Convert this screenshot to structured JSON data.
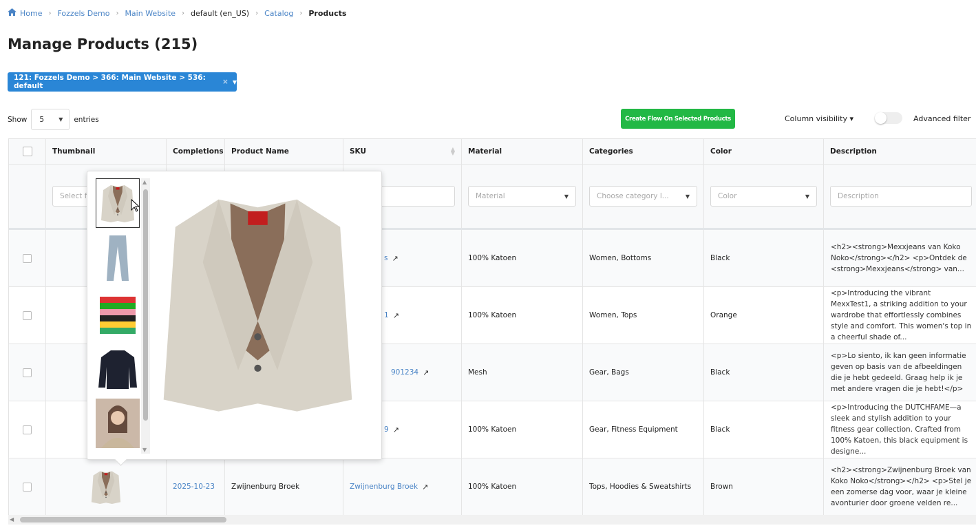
{
  "breadcrumb": [
    {
      "label": "Home",
      "link": true
    },
    {
      "label": "Fozzels Demo",
      "link": true
    },
    {
      "label": "Main Website",
      "link": true
    },
    {
      "label": "default (en_US)",
      "link": false
    },
    {
      "label": "Catalog",
      "link": true
    },
    {
      "label": "Products",
      "current": true
    }
  ],
  "page_title": "Manage Products (215)",
  "store_selector": {
    "label": "121: Fozzels Demo > 366: Main Website > 536: default",
    "clear": "×",
    "caret": "▼"
  },
  "length": {
    "show": "Show",
    "value": "5",
    "entries": "entries"
  },
  "create_flow_label": "Create Flow On Selected Products",
  "column_visibility": "Column visibility ▾",
  "advanced_filter": {
    "label": "Advanced filter",
    "on": false
  },
  "columns": [
    "Thumbnail",
    "Completions",
    "Product Name",
    "SKU",
    "Material",
    "Categories",
    "Color",
    "Description"
  ],
  "filters": {
    "thumbnail": "Select fi",
    "material": "Material",
    "categories": "Choose category l...",
    "color": "Color",
    "description": "Description"
  },
  "rows": [
    {
      "completions": "",
      "name": "",
      "sku": "s",
      "material": "100% Katoen",
      "categories": "Women, Bottoms",
      "color": "Black",
      "description": "<h2><strong>Mexxjeans van Koko Noko</strong></h2>\n<p>Ontdek de <strong>Mexxjeans</strong> van..."
    },
    {
      "completions": "",
      "name": "",
      "sku": "1",
      "material": "100% Katoen",
      "categories": "Women, Tops",
      "color": "Orange",
      "description": "<p>Introducing the vibrant MexxTest1, a striking addition to your wardrobe that effortlessly combines style and comfort. This women's top in a cheerful shade of..."
    },
    {
      "completions": "",
      "name": "",
      "sku": "901234",
      "material": "Mesh",
      "categories": "Gear, Bags",
      "color": "Black",
      "description": "<p>Lo siento, ik kan geen informatie geven op basis van de afbeeldingen die je hebt gedeeld. Graag help ik je met andere vragen die je hebt!</p>"
    },
    {
      "completions": "",
      "name": "",
      "sku": "9",
      "material": "100% Katoen",
      "categories": "Gear, Fitness Equipment",
      "color": "Black",
      "description": "<p>Introducing the DUTCHFAME—a sleek and stylish addition to your fitness gear collection. Crafted from 100% Katoen, this black equipment is designe..."
    },
    {
      "completions": "2025-10-23",
      "name": "Zwijnenburg Broek",
      "sku": "Zwijnenburg Broek",
      "material": "100% Katoen",
      "categories": "Tops, Hoodies & Sweatshirts",
      "color": "Brown",
      "description": "<h2><strong>Zwijnenburg Broek van Koko Noko</strong></h2>\n<p>Stel je een zomerse dag voor, waar je kleine avonturier door groene velden re..."
    }
  ],
  "gallery": {
    "thumbnails": [
      "beige-blazer",
      "grey-trousers",
      "striped-sweater",
      "black-sweater",
      "woman-portrait"
    ],
    "active": 0
  },
  "colors": {
    "accent": "#2a86d6",
    "green": "#22b845",
    "link": "#4a84c6"
  }
}
